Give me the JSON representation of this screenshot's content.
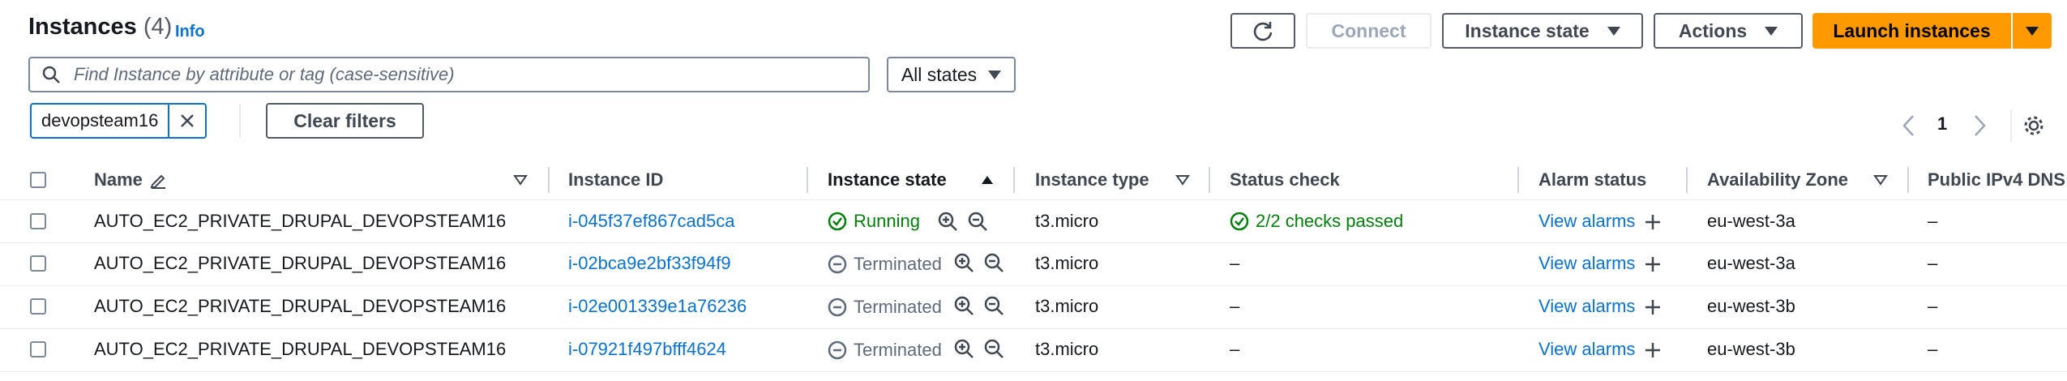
{
  "header": {
    "title": "Instances",
    "count": "(4)",
    "info": "Info"
  },
  "toolbar": {
    "refresh_icon": "refresh-icon",
    "connect": "Connect",
    "instance_state": "Instance state",
    "actions": "Actions",
    "launch": "Launch instances"
  },
  "search": {
    "placeholder": "Find Instance by attribute or tag (case-sensitive)",
    "states_select": "All states"
  },
  "filters": {
    "token": "devopsteam16",
    "clear": "Clear filters"
  },
  "pagination": {
    "page": "1"
  },
  "table": {
    "columns": [
      "Name",
      "Instance ID",
      "Instance state",
      "Instance type",
      "Status check",
      "Alarm status",
      "Availability Zone",
      "Public IPv4 DNS"
    ],
    "rows": [
      {
        "name": "AUTO_EC2_PRIVATE_DRUPAL_DEVOPSTEAM16",
        "id": "i-045f37ef867cad5ca",
        "state": "Running",
        "type": "t3.micro",
        "status": "2/2 checks passed",
        "alarm": "View alarms",
        "az": "eu-west-3a",
        "dns": "–"
      },
      {
        "name": "AUTO_EC2_PRIVATE_DRUPAL_DEVOPSTEAM16",
        "id": "i-02bca9e2bf33f94f9",
        "state": "Terminated",
        "type": "t3.micro",
        "status": "–",
        "alarm": "View alarms",
        "az": "eu-west-3a",
        "dns": "–"
      },
      {
        "name": "AUTO_EC2_PRIVATE_DRUPAL_DEVOPSTEAM16",
        "id": "i-02e001339e1a76236",
        "state": "Terminated",
        "type": "t3.micro",
        "status": "–",
        "alarm": "View alarms",
        "az": "eu-west-3b",
        "dns": "–"
      },
      {
        "name": "AUTO_EC2_PRIVATE_DRUPAL_DEVOPSTEAM16",
        "id": "i-07921f497bfff4624",
        "state": "Terminated",
        "type": "t3.micro",
        "status": "–",
        "alarm": "View alarms",
        "az": "eu-west-3b",
        "dns": "–"
      }
    ]
  },
  "colors": {
    "link": "#0972d3",
    "running": "#037f0c",
    "primary": "#ff9900"
  }
}
